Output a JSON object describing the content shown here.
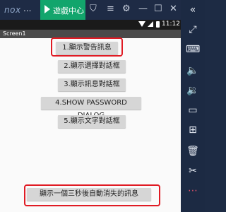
{
  "emulator": {
    "logo": "nox",
    "more": "...",
    "game_center_label": "遊戲中心"
  },
  "status_bar": {
    "time": "11:12"
  },
  "app": {
    "screen_title": "Screen1",
    "buttons": [
      {
        "label": "1.顯示警告訊息"
      },
      {
        "label": "2.顯示選擇對話框"
      },
      {
        "label": "3.顯示訊息對話框"
      },
      {
        "label": "4.SHOW PASSWORD DIALOG"
      },
      {
        "label": "5.顯示文字對話框"
      }
    ],
    "toast_text": "顯示一個三秒後自動消失的訊息"
  },
  "colors": {
    "highlight": "#e01b24",
    "game_center": "#12a56c",
    "button_bg": "#d6d6d6"
  }
}
